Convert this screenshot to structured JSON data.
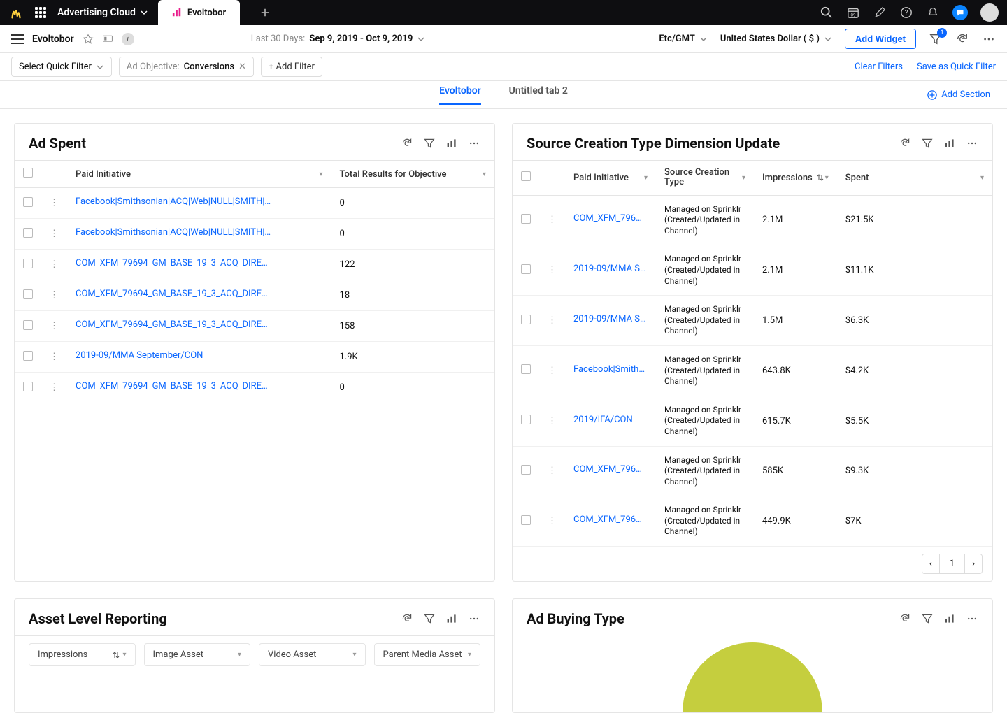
{
  "topbar": {
    "brand": "Advertising Cloud",
    "active_tab": "Evoltobor"
  },
  "subbar": {
    "page_title": "Evoltobor",
    "date_label": "Last 30 Days:",
    "date_range": "Sep 9, 2019 - Oct 9, 2019",
    "timezone": "Etc/GMT",
    "currency": "United States Dollar ( $ )",
    "add_widget": "Add Widget",
    "funnel_badge": "1"
  },
  "filterbar": {
    "quick_filter": "Select Quick Filter",
    "filter_label": "Ad Objective:",
    "filter_value": "Conversions",
    "add_filter": "+ Add Filter",
    "clear": "Clear Filters",
    "save": "Save as Quick Filter"
  },
  "tabs": {
    "tab1": "Evoltobor",
    "tab2": "Untitled tab 2",
    "add_section": "Add Section"
  },
  "widget_adspent": {
    "title": "Ad Spent",
    "col1": "Paid Initiative",
    "col2": "Total Results for Objective",
    "rows": [
      {
        "name": "Facebook|Smithsonian|ACQ|Web|NULL|SMITH|Spr...",
        "val": "0"
      },
      {
        "name": "Facebook|Smithsonian|ACQ|Web|NULL|SMITH|Spr...",
        "val": "0"
      },
      {
        "name": "COM_XFM_79694_GM_BASE_19_3_ACQ_DIRECT-A...",
        "val": "122"
      },
      {
        "name": "COM_XFM_79694_GM_BASE_19_3_ACQ_DIRECT-A...",
        "val": "18"
      },
      {
        "name": "COM_XFM_79694_GM_BASE_19_3_ACQ_DIRECT-A...",
        "val": "158"
      },
      {
        "name": "2019-09/MMA September/CON",
        "val": "1.9K"
      },
      {
        "name": "COM_XFM_79694_GM_BASE_19_3_ACQ_DIRECT-A...",
        "val": "0"
      }
    ]
  },
  "widget_sct": {
    "title": "Source Creation Type Dimension Update",
    "col1": "Paid Initiative",
    "col2": "Source Creation Type",
    "col3": "Impressions",
    "col4": "Spent",
    "rows": [
      {
        "name": "COM_XFM_7969...",
        "type": "Managed on Sprinklr (Created/Updated in Channel)",
        "imp": "2.1M",
        "spent": "$21.5K"
      },
      {
        "name": "2019-09/MMA Se...",
        "type": "Managed on Sprinklr (Created/Updated in Channel)",
        "imp": "2.1M",
        "spent": "$11.1K"
      },
      {
        "name": "2019-09/MMA Se...",
        "type": "Managed on Sprinklr (Created/Updated in Channel)",
        "imp": "1.5M",
        "spent": "$6.3K"
      },
      {
        "name": "Facebook|Smiths...",
        "type": "Managed on Sprinklr (Created/Updated in Channel)",
        "imp": "643.8K",
        "spent": "$4.2K"
      },
      {
        "name": "2019/IFA/CON",
        "type": "Managed on Sprinklr (Created/Updated in Channel)",
        "imp": "615.7K",
        "spent": "$5.5K"
      },
      {
        "name": "COM_XFM_7969...",
        "type": "Managed on Sprinklr (Created/Updated in Channel)",
        "imp": "585K",
        "spent": "$9.3K"
      },
      {
        "name": "COM_XFM_7969...",
        "type": "Managed on Sprinklr (Created/Updated in Channel)",
        "imp": "449.9K",
        "spent": "$7K"
      }
    ],
    "page": "1"
  },
  "widget_asset": {
    "title": "Asset Level Reporting",
    "dd1": "Impressions",
    "dd2": "Image Asset",
    "dd3": "Video Asset",
    "dd4": "Parent Media Asset"
  },
  "widget_adbuy": {
    "title": "Ad Buying Type"
  }
}
